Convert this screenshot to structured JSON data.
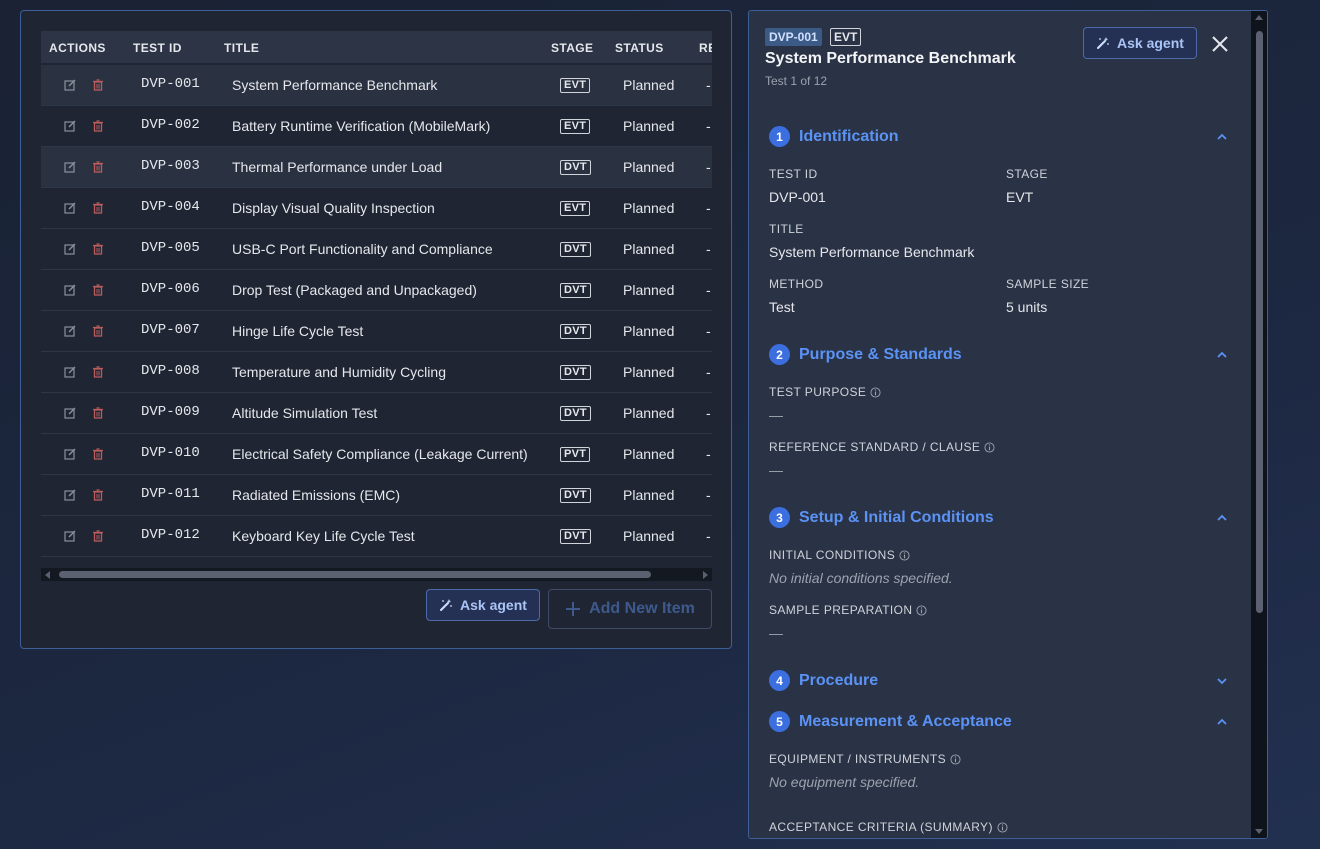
{
  "table": {
    "headers": {
      "actions": "ACTIONS",
      "test_id": "TEST ID",
      "title": "TITLE",
      "stage": "STAGE",
      "status": "STATUS",
      "remaining": "RE"
    },
    "rows": [
      {
        "id": "DVP-001",
        "title": "System Performance Benchmark",
        "stage": "EVT",
        "status": "Planned",
        "extra": "-"
      },
      {
        "id": "DVP-002",
        "title": "Battery Runtime Verification (MobileMark)",
        "stage": "EVT",
        "status": "Planned",
        "extra": "-"
      },
      {
        "id": "DVP-003",
        "title": "Thermal Performance under Load",
        "stage": "DVT",
        "status": "Planned",
        "extra": "-"
      },
      {
        "id": "DVP-004",
        "title": "Display Visual Quality Inspection",
        "stage": "EVT",
        "status": "Planned",
        "extra": "-"
      },
      {
        "id": "DVP-005",
        "title": "USB-C Port Functionality and Compliance",
        "stage": "DVT",
        "status": "Planned",
        "extra": "-"
      },
      {
        "id": "DVP-006",
        "title": "Drop Test (Packaged and Unpackaged)",
        "stage": "DVT",
        "status": "Planned",
        "extra": "-"
      },
      {
        "id": "DVP-007",
        "title": "Hinge Life Cycle Test",
        "stage": "DVT",
        "status": "Planned",
        "extra": "-"
      },
      {
        "id": "DVP-008",
        "title": "Temperature and Humidity Cycling",
        "stage": "DVT",
        "status": "Planned",
        "extra": "-"
      },
      {
        "id": "DVP-009",
        "title": "Altitude Simulation Test",
        "stage": "DVT",
        "status": "Planned",
        "extra": "-"
      },
      {
        "id": "DVP-010",
        "title": "Electrical Safety Compliance (Leakage Current)",
        "stage": "PVT",
        "status": "Planned",
        "extra": "-"
      },
      {
        "id": "DVP-011",
        "title": "Radiated Emissions (EMC)",
        "stage": "DVT",
        "status": "Planned",
        "extra": "-"
      },
      {
        "id": "DVP-012",
        "title": "Keyboard Key Life Cycle Test",
        "stage": "DVT",
        "status": "Planned",
        "extra": "-"
      }
    ]
  },
  "left_actions": {
    "ask_agent": "Ask agent",
    "add_new": "Add New Item"
  },
  "detail": {
    "id_badge": "DVP-001",
    "stage_badge": "EVT",
    "title": "System Performance Benchmark",
    "subtitle": "Test 1 of 12",
    "ask_agent": "Ask agent",
    "sections": [
      {
        "num": "1",
        "label": "Identification"
      },
      {
        "num": "2",
        "label": "Purpose & Standards"
      },
      {
        "num": "3",
        "label": "Setup & Initial Conditions"
      },
      {
        "num": "4",
        "label": "Procedure"
      },
      {
        "num": "5",
        "label": "Measurement & Acceptance"
      }
    ],
    "identification": {
      "test_id_label": "TEST ID",
      "test_id": "DVP-001",
      "stage_label": "STAGE",
      "stage": "EVT",
      "title_label": "TITLE",
      "title": "System Performance Benchmark",
      "method_label": "METHOD",
      "method": "Test",
      "sample_size_label": "SAMPLE SIZE",
      "sample_size": "5 units"
    },
    "purpose": {
      "test_purpose_label": "TEST PURPOSE",
      "test_purpose": "—",
      "reference_label": "REFERENCE STANDARD / CLAUSE",
      "reference": "—"
    },
    "setup": {
      "initial_label": "INITIAL CONDITIONS",
      "initial": "No initial conditions specified.",
      "prep_label": "SAMPLE PREPARATION",
      "prep": "—"
    },
    "measurement": {
      "equipment_label": "EQUIPMENT / INSTRUMENTS",
      "equipment": "No equipment specified.",
      "acceptance_label": "ACCEPTANCE CRITERIA (SUMMARY)"
    }
  },
  "colors": {
    "accent": "#5b93f5",
    "panel_border": "#3d5f95",
    "section_number": "#3b6fe0",
    "trash": "#b85c5c"
  },
  "icons": {
    "edit": "pencil-square-icon",
    "delete": "trash-icon",
    "agent": "magic-wand-icon",
    "add": "plus-icon",
    "close": "close-icon",
    "collapse": "chevron-up-icon",
    "expand": "chevron-down-icon",
    "info": "info-circle-icon"
  }
}
